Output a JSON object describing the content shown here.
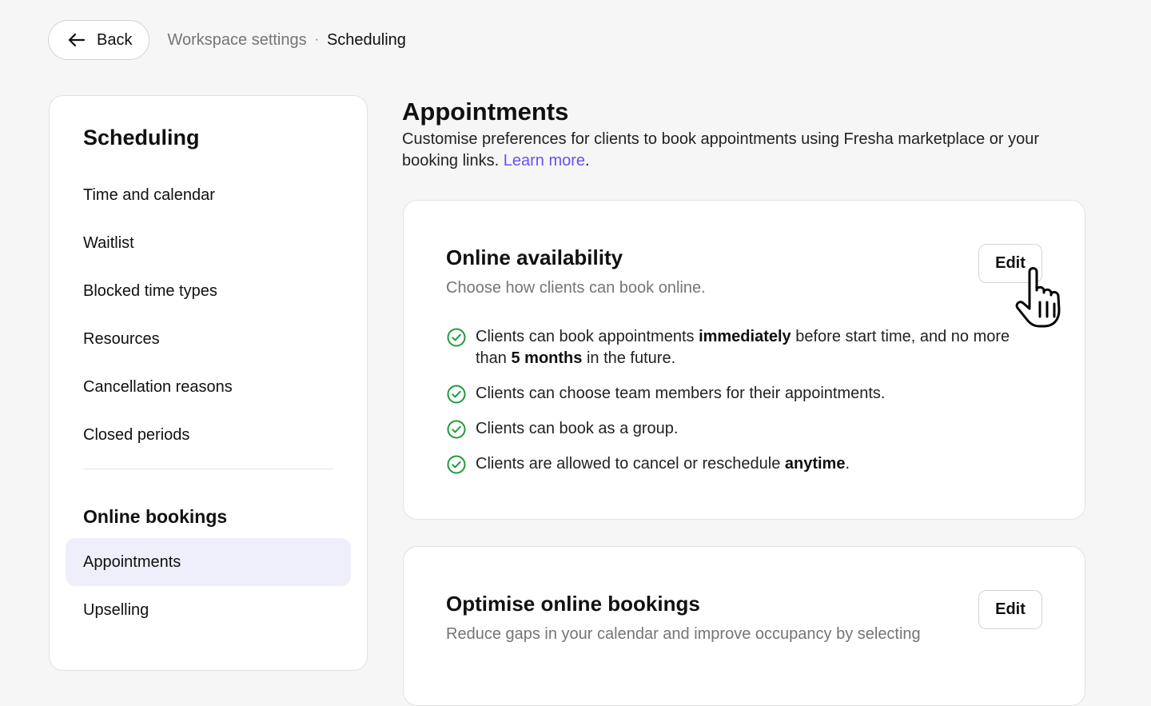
{
  "header": {
    "back_label": "Back",
    "breadcrumb_parent": "Workspace settings",
    "breadcrumb_separator": "·",
    "breadcrumb_current": "Scheduling"
  },
  "sidebar": {
    "title": "Scheduling",
    "items": [
      {
        "label": "Time and calendar"
      },
      {
        "label": "Waitlist"
      },
      {
        "label": "Blocked time types"
      },
      {
        "label": "Resources"
      },
      {
        "label": "Cancellation reasons"
      },
      {
        "label": "Closed periods"
      }
    ],
    "section_title": "Online bookings",
    "section_items": [
      {
        "label": "Appointments",
        "active": true
      },
      {
        "label": "Upselling"
      }
    ]
  },
  "main": {
    "title": "Appointments",
    "description": "Customise preferences for clients to book appointments using Fresha marketplace or your booking links.",
    "learn_more": "Learn more",
    "description_end": "."
  },
  "online_availability": {
    "title": "Online availability",
    "subtitle": "Choose how clients can book online.",
    "edit_label": "Edit",
    "rules": {
      "r1_a": "Clients can book appointments ",
      "r1_b": "immediately",
      "r1_c": " before start time, and no more than ",
      "r1_d": "5 months",
      "r1_e": " in the future.",
      "r2": "Clients can choose team members for their appointments.",
      "r3": "Clients can book as a group.",
      "r4_a": "Clients are allowed to cancel or reschedule ",
      "r4_b": "anytime",
      "r4_c": "."
    }
  },
  "optimise": {
    "title": "Optimise online bookings",
    "subtitle": "Reduce gaps in your calendar and improve occupancy by selecting",
    "edit_label": "Edit"
  },
  "colors": {
    "accent": "#6950f3",
    "check_green": "#1e9a3d",
    "active_item_bg": "#efeffb"
  },
  "icons": {
    "back": "arrow-left-icon",
    "check": "check-circle-icon",
    "cursor": "hand-pointer-icon"
  }
}
